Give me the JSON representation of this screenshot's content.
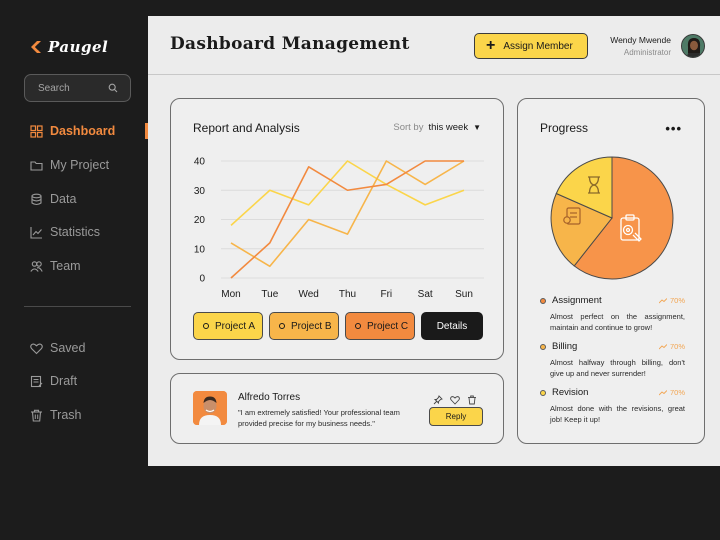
{
  "brand": {
    "name": "Paugel"
  },
  "search": {
    "placeholder": "Search"
  },
  "sidebar": {
    "items": [
      {
        "label": "Dashboard",
        "icon": "grid-icon"
      },
      {
        "label": "My Project",
        "icon": "folder-icon"
      },
      {
        "label": "Data",
        "icon": "database-icon"
      },
      {
        "label": "Statistics",
        "icon": "chart-line-icon"
      },
      {
        "label": "Team",
        "icon": "users-icon"
      }
    ],
    "secondary": [
      {
        "label": "Saved",
        "icon": "heart-icon"
      },
      {
        "label": "Draft",
        "icon": "draft-icon"
      },
      {
        "label": "Trash",
        "icon": "trash-icon"
      }
    ]
  },
  "header": {
    "title": "Dashboard Management",
    "assign_label": "Assign Member",
    "user_name": "Wendy Mwende",
    "user_role": "Administrator"
  },
  "report": {
    "title": "Report and Analysis",
    "sort_label": "Sort by",
    "sort_value": "this week",
    "projects": [
      "Project A",
      "Project B",
      "Project C"
    ],
    "details_label": "Details"
  },
  "chart_data": {
    "type": "line",
    "title": "Report and Analysis",
    "categories": [
      "Mon",
      "Tue",
      "Wed",
      "Thu",
      "Fri",
      "Sat",
      "Sun"
    ],
    "ylim": [
      0,
      40
    ],
    "yticks": [
      0,
      10,
      20,
      30,
      40
    ],
    "grid": true,
    "series": [
      {
        "name": "Project A",
        "color": "#fbd54a",
        "values": [
          18,
          30,
          25,
          40,
          32,
          25,
          30
        ]
      },
      {
        "name": "Project B",
        "color": "#f7b54a",
        "values": [
          12,
          4,
          20,
          15,
          40,
          32,
          40
        ]
      },
      {
        "name": "Project C",
        "color": "#f28a3f",
        "values": [
          0,
          12,
          38,
          30,
          32,
          40,
          40
        ]
      }
    ]
  },
  "review": {
    "name": "Alfredo Torres",
    "text": "\"I am extremely satisfied! Your professional team provided precise for my business needs.\"",
    "reply_label": "Reply"
  },
  "progress": {
    "title": "Progress",
    "more_label": "•••",
    "items": [
      {
        "label": "Assignment",
        "percent": "70%",
        "value": 70,
        "description": "Almost perfect on the assignment, maintain and continue to grow!",
        "color": "#f28a3f"
      },
      {
        "label": "Billing",
        "percent": "70%",
        "value": 70,
        "description": "Almost halfway through billing, don't give up and never surrender!",
        "color": "#f7b54a"
      },
      {
        "label": "Revision",
        "percent": "70%",
        "value": 70,
        "description": "Almost done with the revisions, great job! Keep it up!",
        "color": "#fbd54a"
      }
    ]
  },
  "colors": {
    "accent": "#f28a3f",
    "yellow": "#fbd54a",
    "mid_orange": "#f7b54a",
    "dark": "#1c1c1c"
  }
}
